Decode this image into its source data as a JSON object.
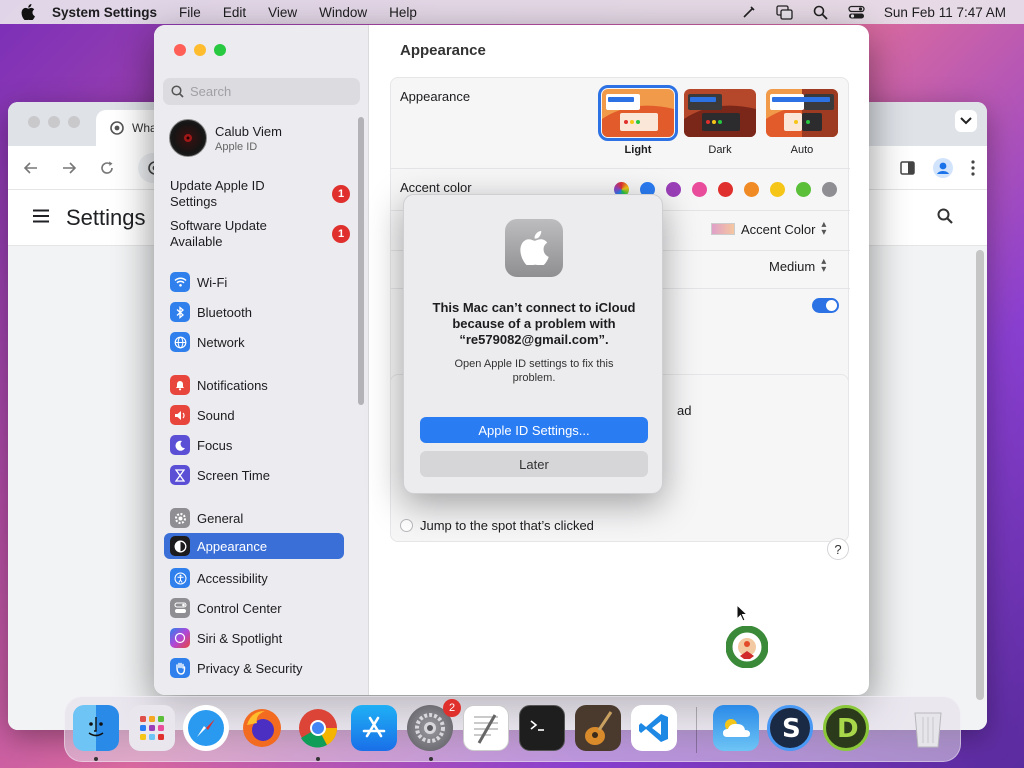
{
  "menubar": {
    "app_name": "System Settings",
    "menus": [
      "File",
      "Edit",
      "View",
      "Window",
      "Help"
    ],
    "datetime": "Sun Feb 11  7:47 AM"
  },
  "chrome": {
    "tab_title": "Wha",
    "page_title": "Settings"
  },
  "sidebar": {
    "search_placeholder": "Search",
    "account": {
      "name": "Calub Viem",
      "subtitle": "Apple ID"
    },
    "notices": [
      {
        "label": "Update Apple ID Settings",
        "badge": "1"
      },
      {
        "label": "Software Update Available",
        "badge": "1"
      }
    ],
    "items": [
      {
        "label": "Wi-Fi",
        "icon": "wifi-icon",
        "color": "#2f80ed"
      },
      {
        "label": "Bluetooth",
        "icon": "bluetooth-icon",
        "color": "#2f80ed"
      },
      {
        "label": "Network",
        "icon": "globe-icon",
        "color": "#2f80ed"
      },
      {
        "label": "Notifications",
        "icon": "bell-icon",
        "color": "#e8453c"
      },
      {
        "label": "Sound",
        "icon": "speaker-icon",
        "color": "#e8453c"
      },
      {
        "label": "Focus",
        "icon": "moon-icon",
        "color": "#5b4fd6"
      },
      {
        "label": "Screen Time",
        "icon": "hourglass-icon",
        "color": "#5b4fd6"
      },
      {
        "label": "General",
        "icon": "gear-icon",
        "color": "#8e8e93"
      },
      {
        "label": "Appearance",
        "icon": "appearance-icon",
        "color": "#1c1c1e"
      },
      {
        "label": "Accessibility",
        "icon": "accessibility-icon",
        "color": "#2f80ed"
      },
      {
        "label": "Control Center",
        "icon": "control-center-icon",
        "color": "#8e8e93"
      },
      {
        "label": "Siri & Spotlight",
        "icon": "siri-icon",
        "color": "#6a3fd8"
      },
      {
        "label": "Privacy & Security",
        "icon": "hand-icon",
        "color": "#2f80ed"
      }
    ],
    "selected": "Appearance"
  },
  "main": {
    "title": "Appearance",
    "appearance_label": "Appearance",
    "modes": [
      "Light",
      "Dark",
      "Auto"
    ],
    "selected_mode": "Light",
    "accent_label": "Accent color",
    "accent_colors": [
      "#9b59d0",
      "#2a7cf3",
      "#9b3fb8",
      "#ea4c9c",
      "#e0302d",
      "#f08a24",
      "#f5c518",
      "#5bbf3a",
      "#8e8e93"
    ],
    "highlight_value": "Accent Color",
    "sidebar_icon_size": "Medium",
    "partial_a": "ad",
    "scroll_click_option": "Jump to the spot that’s clicked",
    "help": "?"
  },
  "alert": {
    "title": "This Mac can’t connect to iCloud because of a problem with “re579082@gmail.com”.",
    "message": "Open Apple ID settings to fix this problem.",
    "primary_button": "Apple ID Settings...",
    "secondary_button": "Later"
  },
  "dock": {
    "apps": [
      "Finder",
      "Launchpad",
      "Safari",
      "Firefox",
      "Chrome",
      "App Store",
      "System Settings",
      "TextEdit",
      "Terminal",
      "GarageBand",
      "VS Code",
      "Weather",
      "Scrivener",
      "Dash",
      "Trash"
    ],
    "settings_badge": "2"
  }
}
